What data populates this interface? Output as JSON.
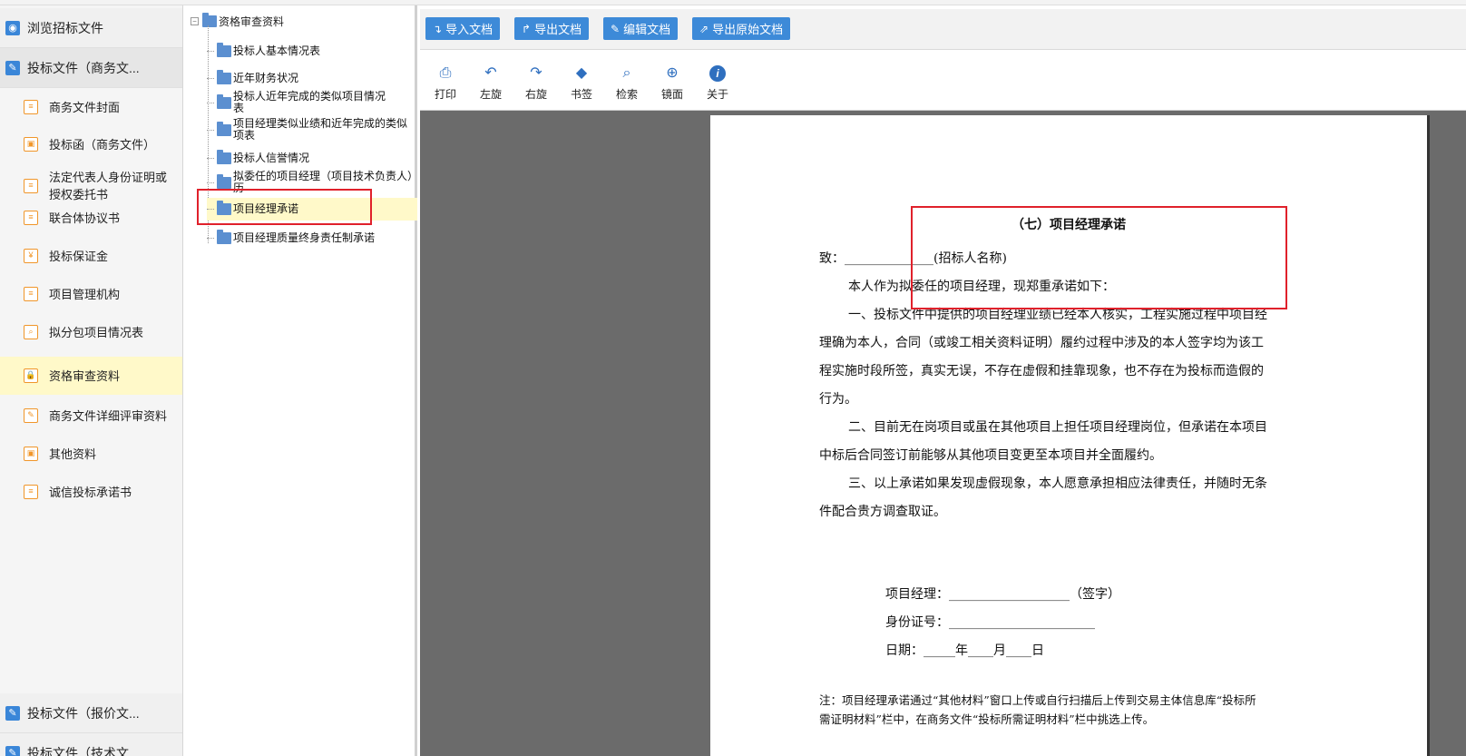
{
  "left_nav": {
    "headers": {
      "browse": "浏览招标文件",
      "commercial": "投标文件（商务文...",
      "price": "投标文件（报价文...",
      "technical": "投标文件（技术文..."
    },
    "items": [
      {
        "label": "商务文件封面",
        "icon": "document-icon"
      },
      {
        "label": "投标函（商务文件）",
        "icon": "form-icon"
      },
      {
        "label": "法定代表人身份证明或授权委托书",
        "icon": "document-icon"
      },
      {
        "label": "联合体协议书",
        "icon": "document-icon"
      },
      {
        "label": "投标保证金",
        "icon": "money-icon"
      },
      {
        "label": "项目管理机构",
        "icon": "document-icon"
      },
      {
        "label": "拟分包项目情况表",
        "icon": "search-icon"
      },
      {
        "label": "资格审查资料",
        "icon": "lock-icon"
      },
      {
        "label": "商务文件详细评审资料",
        "icon": "edit-icon"
      },
      {
        "label": "其他资料",
        "icon": "form-icon"
      },
      {
        "label": "诚信投标承诺书",
        "icon": "document-icon"
      }
    ]
  },
  "tree": {
    "root": "资格审查资料",
    "nodes": [
      {
        "label": "投标人基本情况表"
      },
      {
        "label": "近年财务状况"
      },
      {
        "label": "投标人近年完成的类似项目情况表"
      },
      {
        "label": "项目经理类似业绩和近年完成的类似项表"
      },
      {
        "label": "投标人信誉情况"
      },
      {
        "label": "拟委任的项目经理（项目技术负责人）历"
      },
      {
        "label": "项目经理承诺"
      },
      {
        "label": "项目经理质量终身责任制承诺"
      }
    ]
  },
  "toolbar": {
    "import": "导入文档",
    "export": "导出文档",
    "edit": "编辑文档",
    "export_original": "导出原始文档"
  },
  "viewer_tools": {
    "print": "打印",
    "rotate_left": "左旋",
    "rotate_right": "右旋",
    "bookmark": "书签",
    "find": "检索",
    "mirror": "镜面",
    "about": "关于"
  },
  "document": {
    "title": "（七）项目经理承诺",
    "to": "致：______________(招标人名称)",
    "intro": "本人作为拟委任的项目经理，现郑重承诺如下：",
    "p1_l1": "一、投标文件中提供的项目经理业绩已经本人核实，工程实施过程中项目经",
    "p1_l2": "理确为本人，合同（或竣工相关资料证明）履约过程中涉及的本人签字均为该工",
    "p1_l3": "程实施时段所签，真实无误，不存在虚假和挂靠现象，也不存在为投标而造假的",
    "p1_l4": "行为。",
    "p2_l1": "二、目前无在岗项目或虽在其他项目上担任项目经理岗位，但承诺在本项目",
    "p2_l2": "中标后合同签订前能够从其他项目变更至本项目并全面履约。",
    "p3_l1": "三、以上承诺如果发现虚假现象，本人愿意承担相应法律责任，并随时无条",
    "p3_l2": "件配合贵方调查取证。",
    "sign_pm": "项目经理：___________________（签字）",
    "sign_id": "身份证号：_______________________",
    "sign_date": "日期：_____年____月____日",
    "note_l1": "注：项目经理承诺通过“其他材料”窗口上传或自行扫描后上传到交易主体信息库“投标所",
    "note_l2": "需证明材料”栏中，在商务文件“投标所需证明材料”栏中挑选上传。"
  }
}
